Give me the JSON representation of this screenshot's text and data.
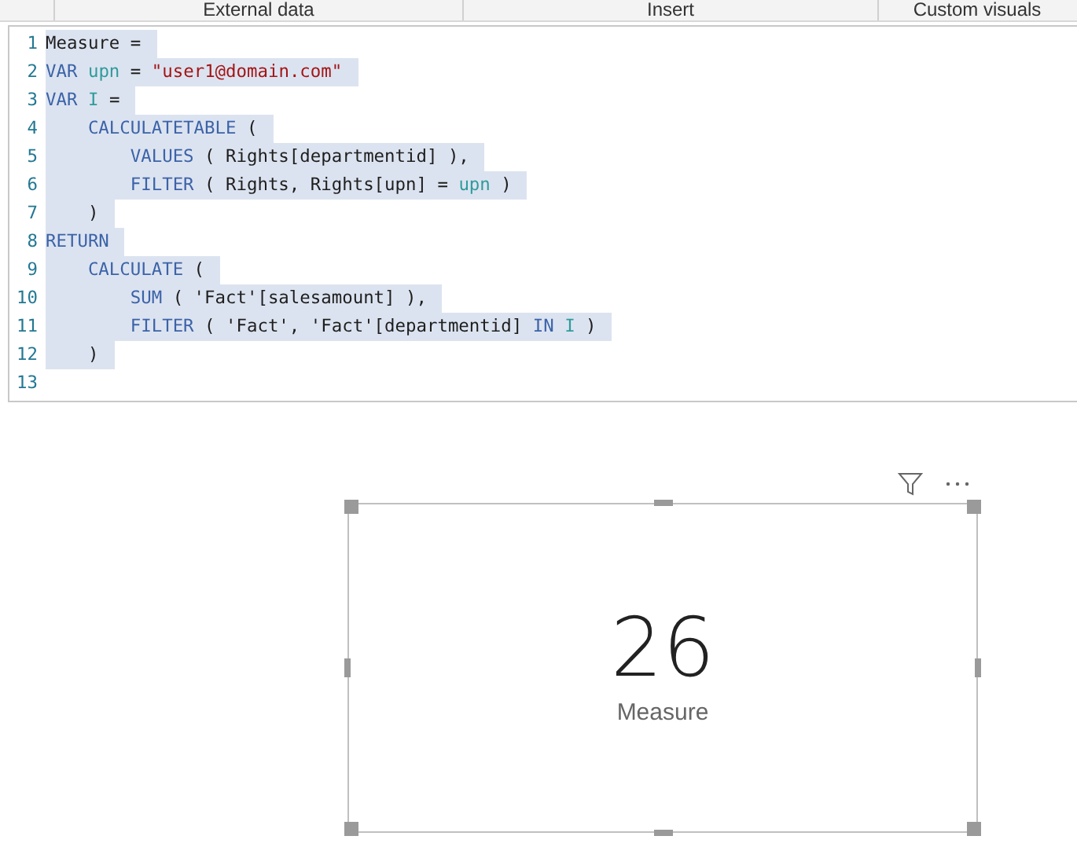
{
  "ribbon": {
    "groups": [
      "External data",
      "Insert",
      "Custom visuals"
    ]
  },
  "editor": {
    "lines": [
      {
        "number": "1",
        "selected": true,
        "tokens": [
          {
            "kind": "plain",
            "text": "Measure ="
          }
        ]
      },
      {
        "number": "2",
        "selected": true,
        "tokens": [
          {
            "kind": "keyword",
            "text": "VAR "
          },
          {
            "kind": "variable",
            "text": "upn"
          },
          {
            "kind": "plain",
            "text": " = "
          },
          {
            "kind": "string",
            "text": "\"user1@domain.com\""
          }
        ]
      },
      {
        "number": "3",
        "selected": true,
        "tokens": [
          {
            "kind": "keyword",
            "text": "VAR "
          },
          {
            "kind": "variable",
            "text": "I"
          },
          {
            "kind": "plain",
            "text": " ="
          }
        ]
      },
      {
        "number": "4",
        "selected": true,
        "tokens": [
          {
            "kind": "keyword",
            "text": "    CALCULATETABLE"
          },
          {
            "kind": "plain",
            "text": " ("
          }
        ]
      },
      {
        "number": "5",
        "selected": true,
        "tokens": [
          {
            "kind": "keyword",
            "text": "        VALUES"
          },
          {
            "kind": "plain",
            "text": " ( Rights[departmentid] ),"
          }
        ]
      },
      {
        "number": "6",
        "selected": true,
        "tokens": [
          {
            "kind": "keyword",
            "text": "        FILTER"
          },
          {
            "kind": "plain",
            "text": " ( Rights, Rights[upn] = "
          },
          {
            "kind": "variable",
            "text": "upn"
          },
          {
            "kind": "plain",
            "text": " )"
          }
        ]
      },
      {
        "number": "7",
        "selected": true,
        "tokens": [
          {
            "kind": "plain",
            "text": "    )"
          }
        ]
      },
      {
        "number": "8",
        "selected": true,
        "tokens": [
          {
            "kind": "keyword",
            "text": "RETURN"
          }
        ]
      },
      {
        "number": "9",
        "selected": true,
        "tokens": [
          {
            "kind": "keyword",
            "text": "    CALCULATE"
          },
          {
            "kind": "plain",
            "text": " ("
          }
        ]
      },
      {
        "number": "10",
        "selected": true,
        "tokens": [
          {
            "kind": "keyword",
            "text": "        SUM"
          },
          {
            "kind": "plain",
            "text": " ( 'Fact'[salesamount] ),"
          }
        ]
      },
      {
        "number": "11",
        "selected": true,
        "tokens": [
          {
            "kind": "keyword",
            "text": "        FILTER"
          },
          {
            "kind": "plain",
            "text": " ( 'Fact', 'Fact'[departmentid] "
          },
          {
            "kind": "keyword",
            "text": "IN "
          },
          {
            "kind": "variable",
            "text": "I"
          },
          {
            "kind": "plain",
            "text": " )"
          }
        ]
      },
      {
        "number": "12",
        "selected": true,
        "tokens": [
          {
            "kind": "plain",
            "text": "    )"
          }
        ]
      },
      {
        "number": "13",
        "selected": false
      }
    ]
  },
  "card_visual": {
    "value": "26",
    "label": "Measure"
  }
}
